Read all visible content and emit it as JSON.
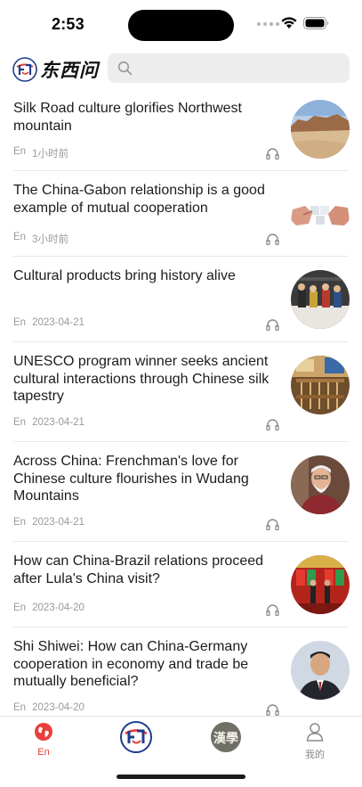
{
  "status_bar": {
    "time": "2:53"
  },
  "header": {
    "logo_text": "东西问",
    "logo_badge_text": "东西问",
    "search_placeholder": ""
  },
  "feed": [
    {
      "title": "Silk Road culture glorifies Northwest mountain",
      "lang": "En",
      "time": "1小时前",
      "image": "desert-rock-landscape"
    },
    {
      "title": "The China-Gabon relationship is a good example of mutual cooperation",
      "lang": "En",
      "time": "3小时前",
      "image": "hands-puzzle-pieces"
    },
    {
      "title": "Cultural products bring history alive",
      "lang": "En",
      "time": "2023-04-21",
      "image": "cultural-figurines-display"
    },
    {
      "title": "UNESCO program winner seeks ancient cultural interactions through Chinese silk tapestry",
      "lang": "En",
      "time": "2023-04-21",
      "image": "silk-loom-workshop"
    },
    {
      "title": "Across China: Frenchman's love for Chinese culture flourishes in Wudang Mountains",
      "lang": "En",
      "time": "2023-04-21",
      "image": "elderly-man-portrait"
    },
    {
      "title": "How can China-Brazil relations proceed after Lula's China visit?",
      "lang": "En",
      "time": "2023-04-20",
      "image": "flags-ceremony-hall"
    },
    {
      "title": "Shi Shiwei: How can China-Germany cooperation in economy and trade be mutually beneficial?",
      "lang": "En",
      "time": "2023-04-20",
      "image": "man-in-suit-portrait"
    }
  ],
  "tabbar": {
    "tabs": [
      {
        "label": "En",
        "icon": "globe-icon",
        "active": true
      },
      {
        "label": "",
        "icon": "dongxiwen-logo-icon",
        "active": false
      },
      {
        "label": "",
        "icon": "hanxue-seal-icon",
        "active": false
      },
      {
        "label": "我的",
        "icon": "person-icon",
        "active": false
      }
    ],
    "seal_text": "漢學"
  },
  "colors": {
    "accent": "#e8403c",
    "meta": "#9a9a9a",
    "divider": "#e9e9e9",
    "search_bg": "#ededed"
  }
}
